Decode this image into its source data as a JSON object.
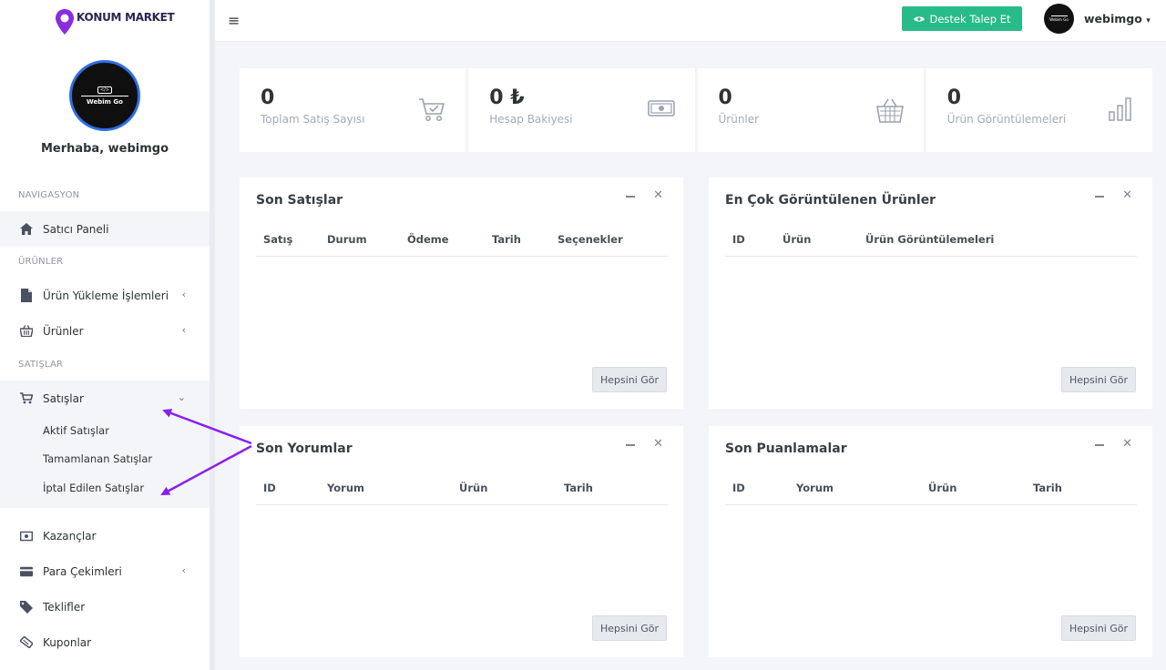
{
  "brand": {
    "name": "KONUM MARKET",
    "avatar_text": "Webim Go",
    "avatar_code": "</>"
  },
  "profile": {
    "greeting": "Merhaba, webimgo"
  },
  "sidebar": {
    "sections": {
      "navigation": "NAVIGASYON",
      "products": "ÜRÜNLER",
      "sales": "SATIŞLAR"
    },
    "items": {
      "dashboard": "Satıcı Paneli",
      "upload": "Ürün Yükleme İşlemleri",
      "products": "Ürünler",
      "sales": "Satışlar",
      "earnings": "Kazançlar",
      "withdrawals": "Para Çekimleri",
      "offers": "Teklifler",
      "coupons": "Kuponlar"
    },
    "sales_submenu": [
      "Aktif Satışlar",
      "Tamamlanan Satışlar",
      "İptal Edilen Satışlar"
    ]
  },
  "topbar": {
    "support_label": "Destek Talep Et",
    "user_name": "webimgo",
    "user_avatar_text": "Webim Go"
  },
  "stats": [
    {
      "value": "0",
      "label": "Toplam Satış Sayısı",
      "icon": "cart-icon"
    },
    {
      "value": "0 ₺",
      "label": "Hesap Bakiyesi",
      "icon": "money-icon"
    },
    {
      "value": "0",
      "label": "Ürünler",
      "icon": "basket-icon"
    },
    {
      "value": "0",
      "label": "Ürün Görüntülemeleri",
      "icon": "bar-chart-icon"
    }
  ],
  "panels": {
    "latest_sales": {
      "title": "Son Satışlar",
      "columns": [
        "Satış",
        "Durum",
        "Ödeme",
        "Tarih",
        "Seçenekler"
      ],
      "button": "Hepsini Gör"
    },
    "most_viewed": {
      "title": "En Çok Görüntülenen Ürünler",
      "columns": [
        "ID",
        "Ürün",
        "Ürün Görüntülemeleri"
      ],
      "button": "Hepsini Gör"
    },
    "latest_comments": {
      "title": "Son Yorumlar",
      "columns": [
        "ID",
        "Yorum",
        "Ürün",
        "Tarih"
      ],
      "button": "Hepsini Gör"
    },
    "latest_ratings": {
      "title": "Son Puanlamalar",
      "columns": [
        "ID",
        "Yorum",
        "Ürün",
        "Tarih"
      ],
      "button": "Hepsini Gör"
    }
  },
  "colors": {
    "accent": "#27bb8a",
    "brand": "#8b2be2",
    "annotation": "#8a1ff0",
    "avatar_border": "#2e6fe3"
  }
}
